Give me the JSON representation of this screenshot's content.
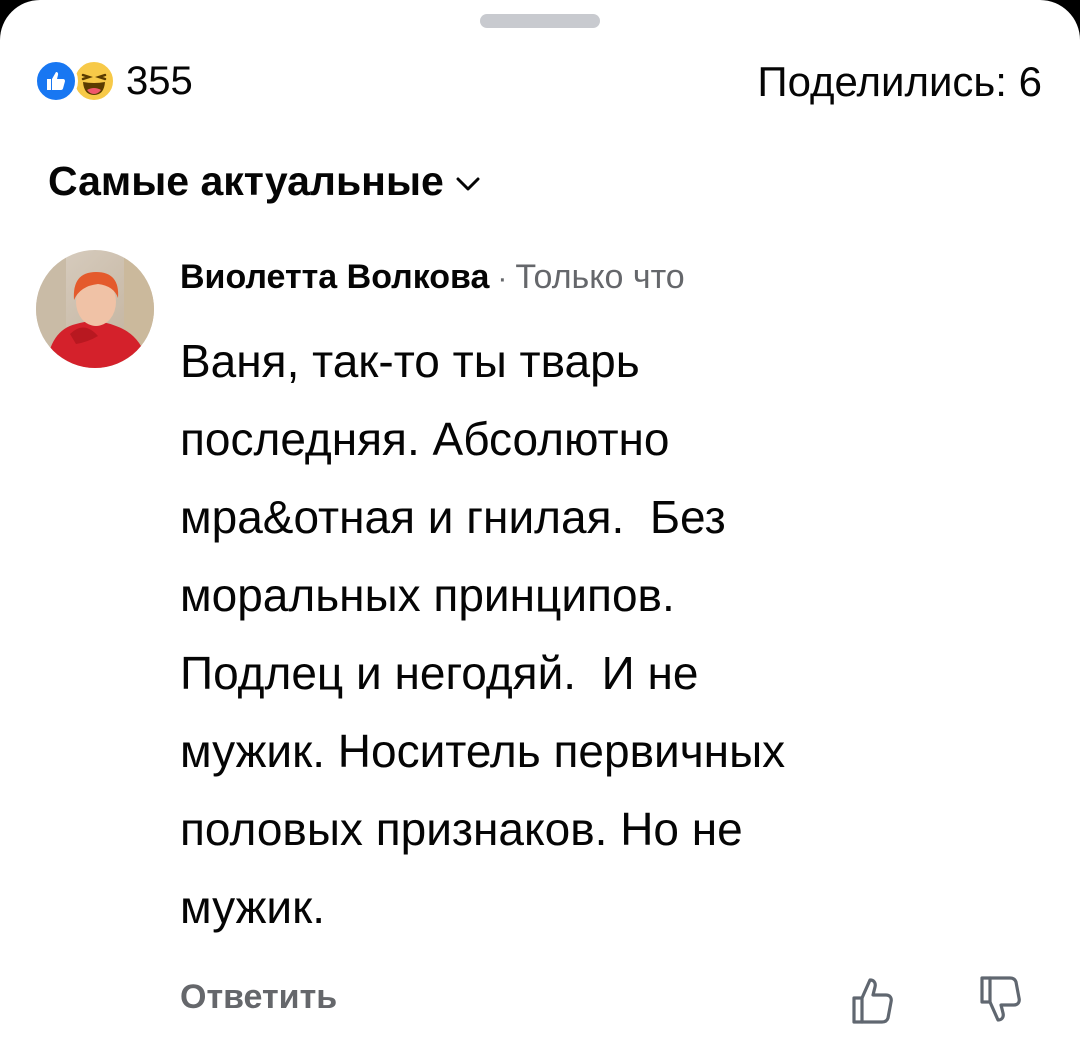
{
  "reactions": {
    "count": "355",
    "icons": [
      "like-icon",
      "haha-icon"
    ],
    "like_color": "#1877f2",
    "haha_color": "#f7c948"
  },
  "shares": {
    "label": "Поделились: 6"
  },
  "sort": {
    "label": "Самые актуальные",
    "icon": "chevron-down-icon"
  },
  "comment": {
    "author": "Виолетта Волкова",
    "separator": "·",
    "time": "Только что",
    "text": "Ваня, так-то ты тварь\nпоследняя. Абсолютно\nмра&отная и гнилая.  Без\nморальных принципов.\nПодлец и негодяй.  И не\nмужик. Носитель первичных\nполовых признаков. Но не\nмужик.",
    "reply_label": "Ответить",
    "actions": [
      "thumbs-up-icon",
      "thumbs-down-icon"
    ]
  },
  "colors": {
    "text_primary": "#050505",
    "text_secondary": "#65676b",
    "background": "#ffffff"
  }
}
